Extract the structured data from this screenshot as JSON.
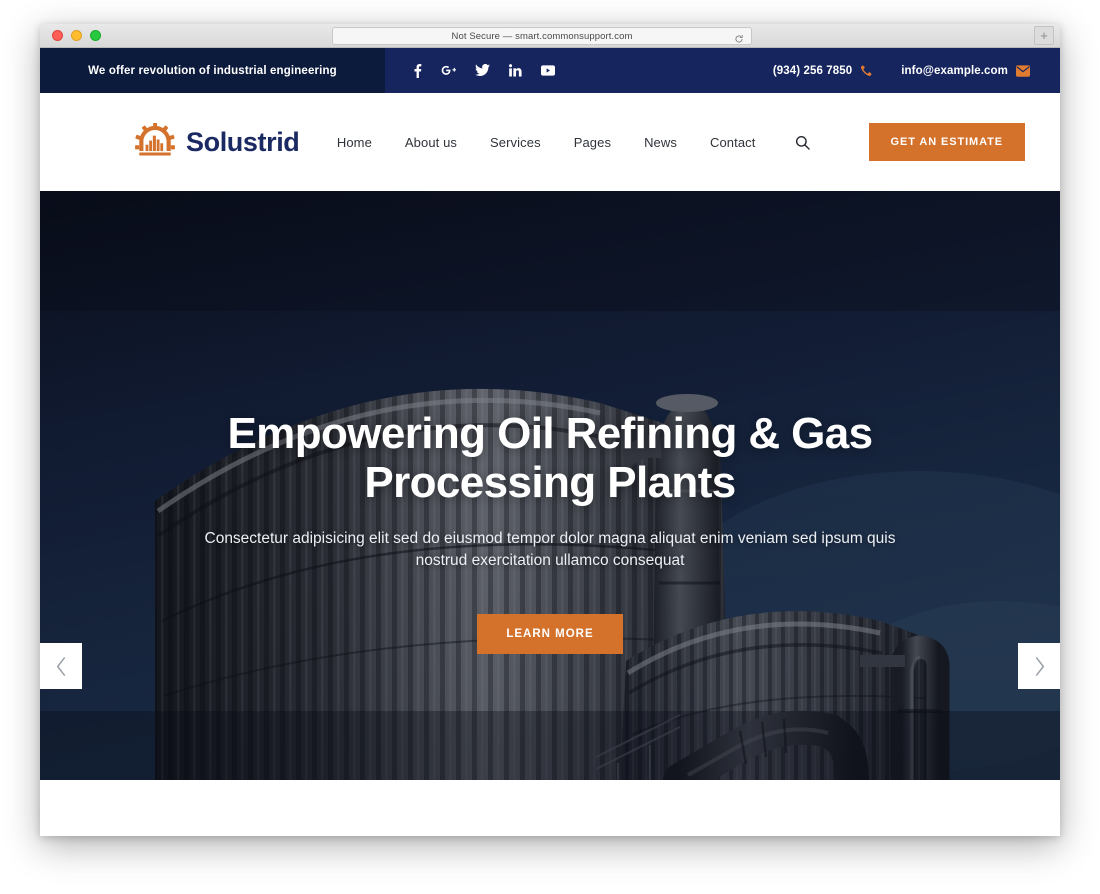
{
  "browser": {
    "url_text": "Not Secure — smart.commonsupport.com",
    "reload_icon": "reload-icon",
    "new_tab_label": "+",
    "traffic_lights": [
      "close-red",
      "minimize-yellow",
      "zoom-green"
    ]
  },
  "topbar": {
    "tagline": "We offer revolution of industrial engineering",
    "socials": [
      {
        "name": "facebook-icon",
        "label": "f"
      },
      {
        "name": "google-plus-icon",
        "label": "G+"
      },
      {
        "name": "twitter-icon",
        "label": "t"
      },
      {
        "name": "linkedin-icon",
        "label": "in"
      },
      {
        "name": "youtube-icon",
        "label": "yt"
      }
    ],
    "phone": "(934) 256 7850",
    "email": "info@example.com",
    "phone_icon": "phone-icon",
    "email_icon": "envelope-icon",
    "bg_left": "#0c1a3c",
    "bg_right": "#16255e"
  },
  "header": {
    "logo_text": "Solustrid",
    "logo_icon": "gear-city-logo-icon",
    "nav": [
      {
        "label": "Home"
      },
      {
        "label": "About us"
      },
      {
        "label": "Services"
      },
      {
        "label": "Pages"
      },
      {
        "label": "News"
      },
      {
        "label": "Contact"
      }
    ],
    "search_icon": "search-icon",
    "estimate_label": "GET AN ESTIMATE",
    "accent_color": "#d4722c",
    "logo_color": "#1c2a63"
  },
  "hero": {
    "title": "Empowering Oil Refining & Gas Processing Plants",
    "subtitle": "Consectetur adipisicing elit sed do eiusmod tempor dolor magna aliquat enim veniam sed ipsum quis nostrud exercitation ullamco consequat",
    "cta_label": "LEARN MORE",
    "prev_arrow": "‹",
    "next_arrow": "›",
    "image_description": "industrial oil refinery storage tanks at dusk"
  }
}
